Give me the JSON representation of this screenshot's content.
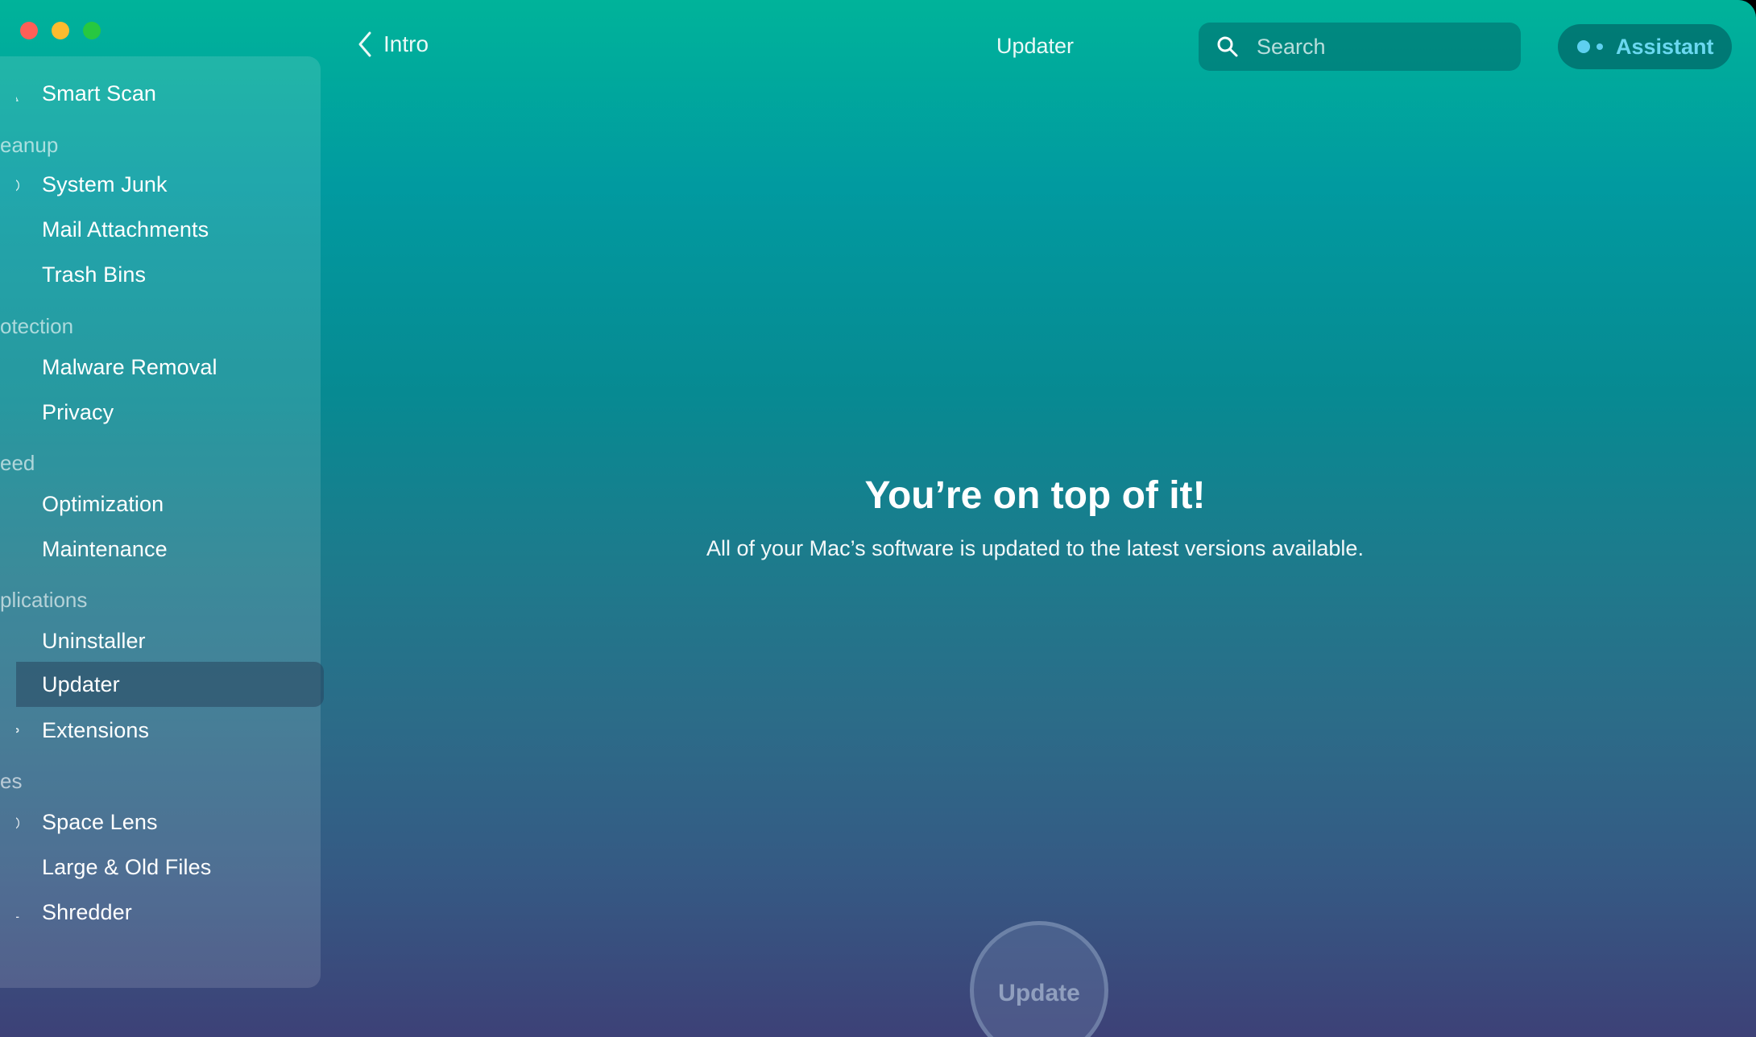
{
  "window": {
    "traffic_lights": [
      "close",
      "minimize",
      "zoom"
    ]
  },
  "header": {
    "back_label": "Intro",
    "title": "Updater",
    "search_placeholder": "Search",
    "assistant_label": "Assistant"
  },
  "sidebar": {
    "smart_scan": "Smart Scan",
    "sections": [
      {
        "label": "eanup",
        "items": [
          "System Junk",
          "Mail Attachments",
          "Trash Bins"
        ]
      },
      {
        "label": "otection",
        "items": [
          "Malware Removal",
          "Privacy"
        ]
      },
      {
        "label": "eed",
        "items": [
          "Optimization",
          "Maintenance"
        ]
      },
      {
        "label": "plications",
        "items": [
          "Uninstaller",
          "Updater",
          "Extensions"
        ]
      },
      {
        "label": "es",
        "items": [
          "Space Lens",
          "Large & Old Files",
          "Shredder"
        ]
      }
    ],
    "active_item": "Updater"
  },
  "main": {
    "headline": "You’re on top of it!",
    "subline": "All of your Mac’s software is updated to the latest versions available.",
    "update_button": "Update"
  },
  "colors": {
    "gradient_top": "#00b39a",
    "gradient_bottom": "#3d4177",
    "assistant_accent": "#6ad8f0"
  }
}
